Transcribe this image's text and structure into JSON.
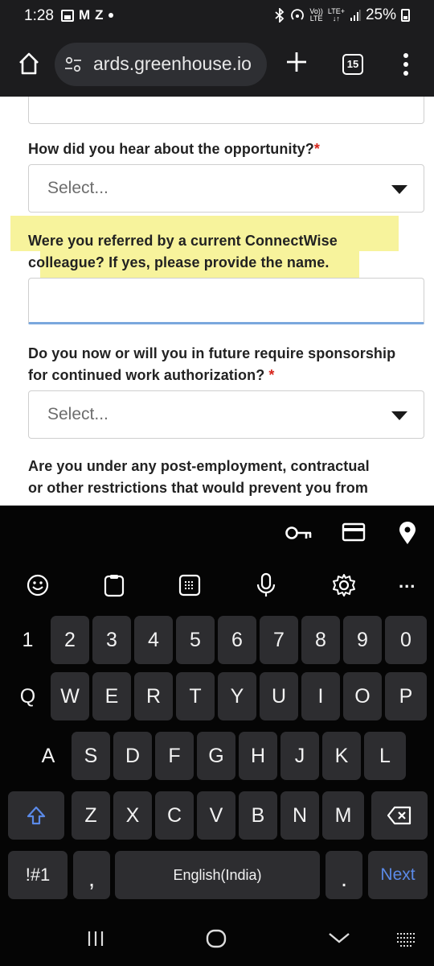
{
  "status_bar": {
    "time": "1:28",
    "notif_letters": [
      "M",
      "Z"
    ],
    "signal_top": "Vo))",
    "signal_bottom": "LTE",
    "net_top": "LTE+",
    "net_bottom": "↓↑",
    "battery": "25%"
  },
  "browser": {
    "url": "ards.greenhouse.io",
    "tab_count": "15"
  },
  "form": {
    "q_hear": "How did you hear about the opportunity?",
    "q_hear_select": "Select...",
    "q_referred_line1": "Were you referred by a current ConnectWise",
    "q_referred_line2": "colleague? If yes, please provide the name.",
    "q_sponsorship_line1": "Do you now or will you in future require sponsorship",
    "q_sponsorship_line2": "for continued work authorization?",
    "q_sponsorship_select": "Select...",
    "q_restrictions_line1": "Are you under any post-employment, contractual",
    "q_restrictions_line2": "or other restrictions that would prevent you from",
    "required_mark": "*",
    "highlight_color": "#f7f39c",
    "required_color": "#d7261c",
    "input_focus_color": "#7aa7dd"
  },
  "keyboard": {
    "number_row": [
      "1",
      "2",
      "3",
      "4",
      "5",
      "6",
      "7",
      "8",
      "9",
      "0"
    ],
    "row1": [
      "Q",
      "W",
      "E",
      "R",
      "T",
      "Y",
      "U",
      "I",
      "O",
      "P"
    ],
    "row2": [
      "A",
      "S",
      "D",
      "F",
      "G",
      "H",
      "J",
      "K",
      "L"
    ],
    "row3": [
      "Z",
      "X",
      "C",
      "V",
      "B",
      "N",
      "M"
    ],
    "symbols_key": "!#1",
    "comma_key": ",",
    "space_label": "English(India)",
    "period_key": ".",
    "next_key": "Next",
    "toolbar_more": "...",
    "next_color": "#5b8ae8"
  }
}
